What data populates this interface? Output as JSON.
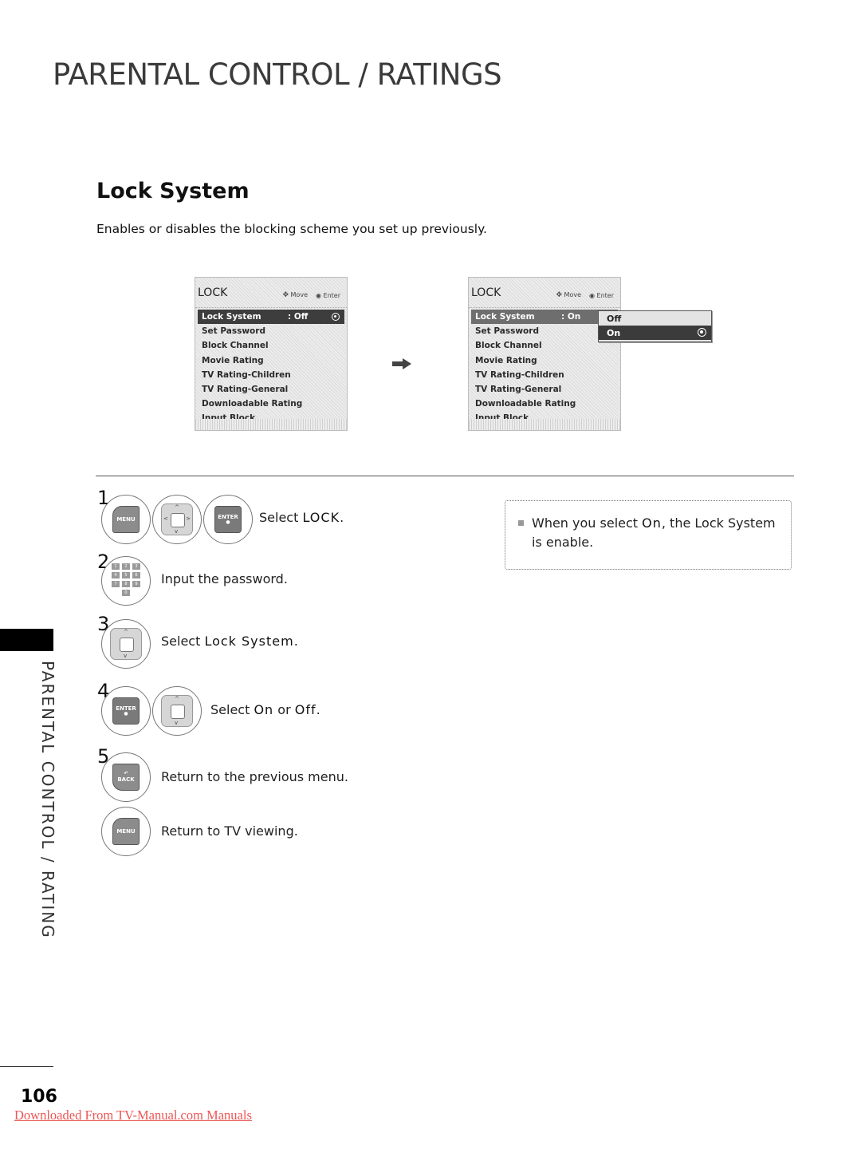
{
  "page": {
    "title": "PARENTAL CONTROL / RATINGS",
    "section_title": "Lock System",
    "section_description": "Enables or disables the blocking scheme you set up previously.",
    "side_tab_label": "PARENTAL CONTROL / RATING",
    "page_number": "106",
    "download_link": "Downloaded From TV-Manual.com Manuals"
  },
  "osd_before": {
    "title": "LOCK",
    "hint_move": "Move",
    "hint_enter": "Enter",
    "items": [
      {
        "label": "Lock System",
        "value": ": Off",
        "selected": true
      },
      {
        "label": "Set Password"
      },
      {
        "label": "Block Channel"
      },
      {
        "label": "Movie Rating"
      },
      {
        "label": "TV Rating-Children"
      },
      {
        "label": "TV Rating-General"
      },
      {
        "label": "Downloadable Rating"
      },
      {
        "label": "Input Block"
      }
    ]
  },
  "osd_after": {
    "title": "LOCK",
    "hint_move": "Move",
    "hint_enter": "Enter",
    "items": [
      {
        "label": "Lock System",
        "value": ": On",
        "selected": true
      },
      {
        "label": "Set Password"
      },
      {
        "label": "Block Channel"
      },
      {
        "label": "Movie Rating"
      },
      {
        "label": "TV Rating-Children"
      },
      {
        "label": "TV Rating-General"
      },
      {
        "label": "Downloadable Rating"
      },
      {
        "label": "Input Block"
      }
    ],
    "popup_options": [
      {
        "label": "Off",
        "selected": false
      },
      {
        "label": "On",
        "selected": true
      }
    ]
  },
  "steps": [
    {
      "number": "1",
      "text_prefix": "Select ",
      "text_bold": "LOCK",
      "text_suffix": ".",
      "buttons": [
        "MENU",
        "NAV",
        "ENTER"
      ]
    },
    {
      "number": "2",
      "text": "Input the password.",
      "buttons": [
        "NUMPAD"
      ]
    },
    {
      "number": "3",
      "text_prefix": "Select ",
      "text_bold": "Lock System",
      "text_suffix": ".",
      "buttons": [
        "NAV_UPDOWN"
      ]
    },
    {
      "number": "4",
      "text_prefix": "Select ",
      "text_bold": "On",
      "text_mid": " or ",
      "text_bold2": "Off",
      "text_suffix": ".",
      "buttons": [
        "ENTER",
        "NAV_UPDOWN"
      ]
    },
    {
      "number": "5",
      "text": "Return to the previous menu.",
      "buttons": [
        "BACK"
      ]
    },
    {
      "number": "",
      "text": "Return to TV viewing.",
      "buttons": [
        "MENU"
      ]
    }
  ],
  "keys": {
    "menu": "MENU",
    "enter": "ENTER",
    "back": "BACK",
    "numpad": [
      "1",
      "2",
      "3",
      "4",
      "5",
      "6",
      "7",
      "8",
      "9",
      "0"
    ]
  },
  "note": {
    "prefix": "When you select ",
    "bold": "On",
    "suffix": ", the Lock System is enable."
  }
}
